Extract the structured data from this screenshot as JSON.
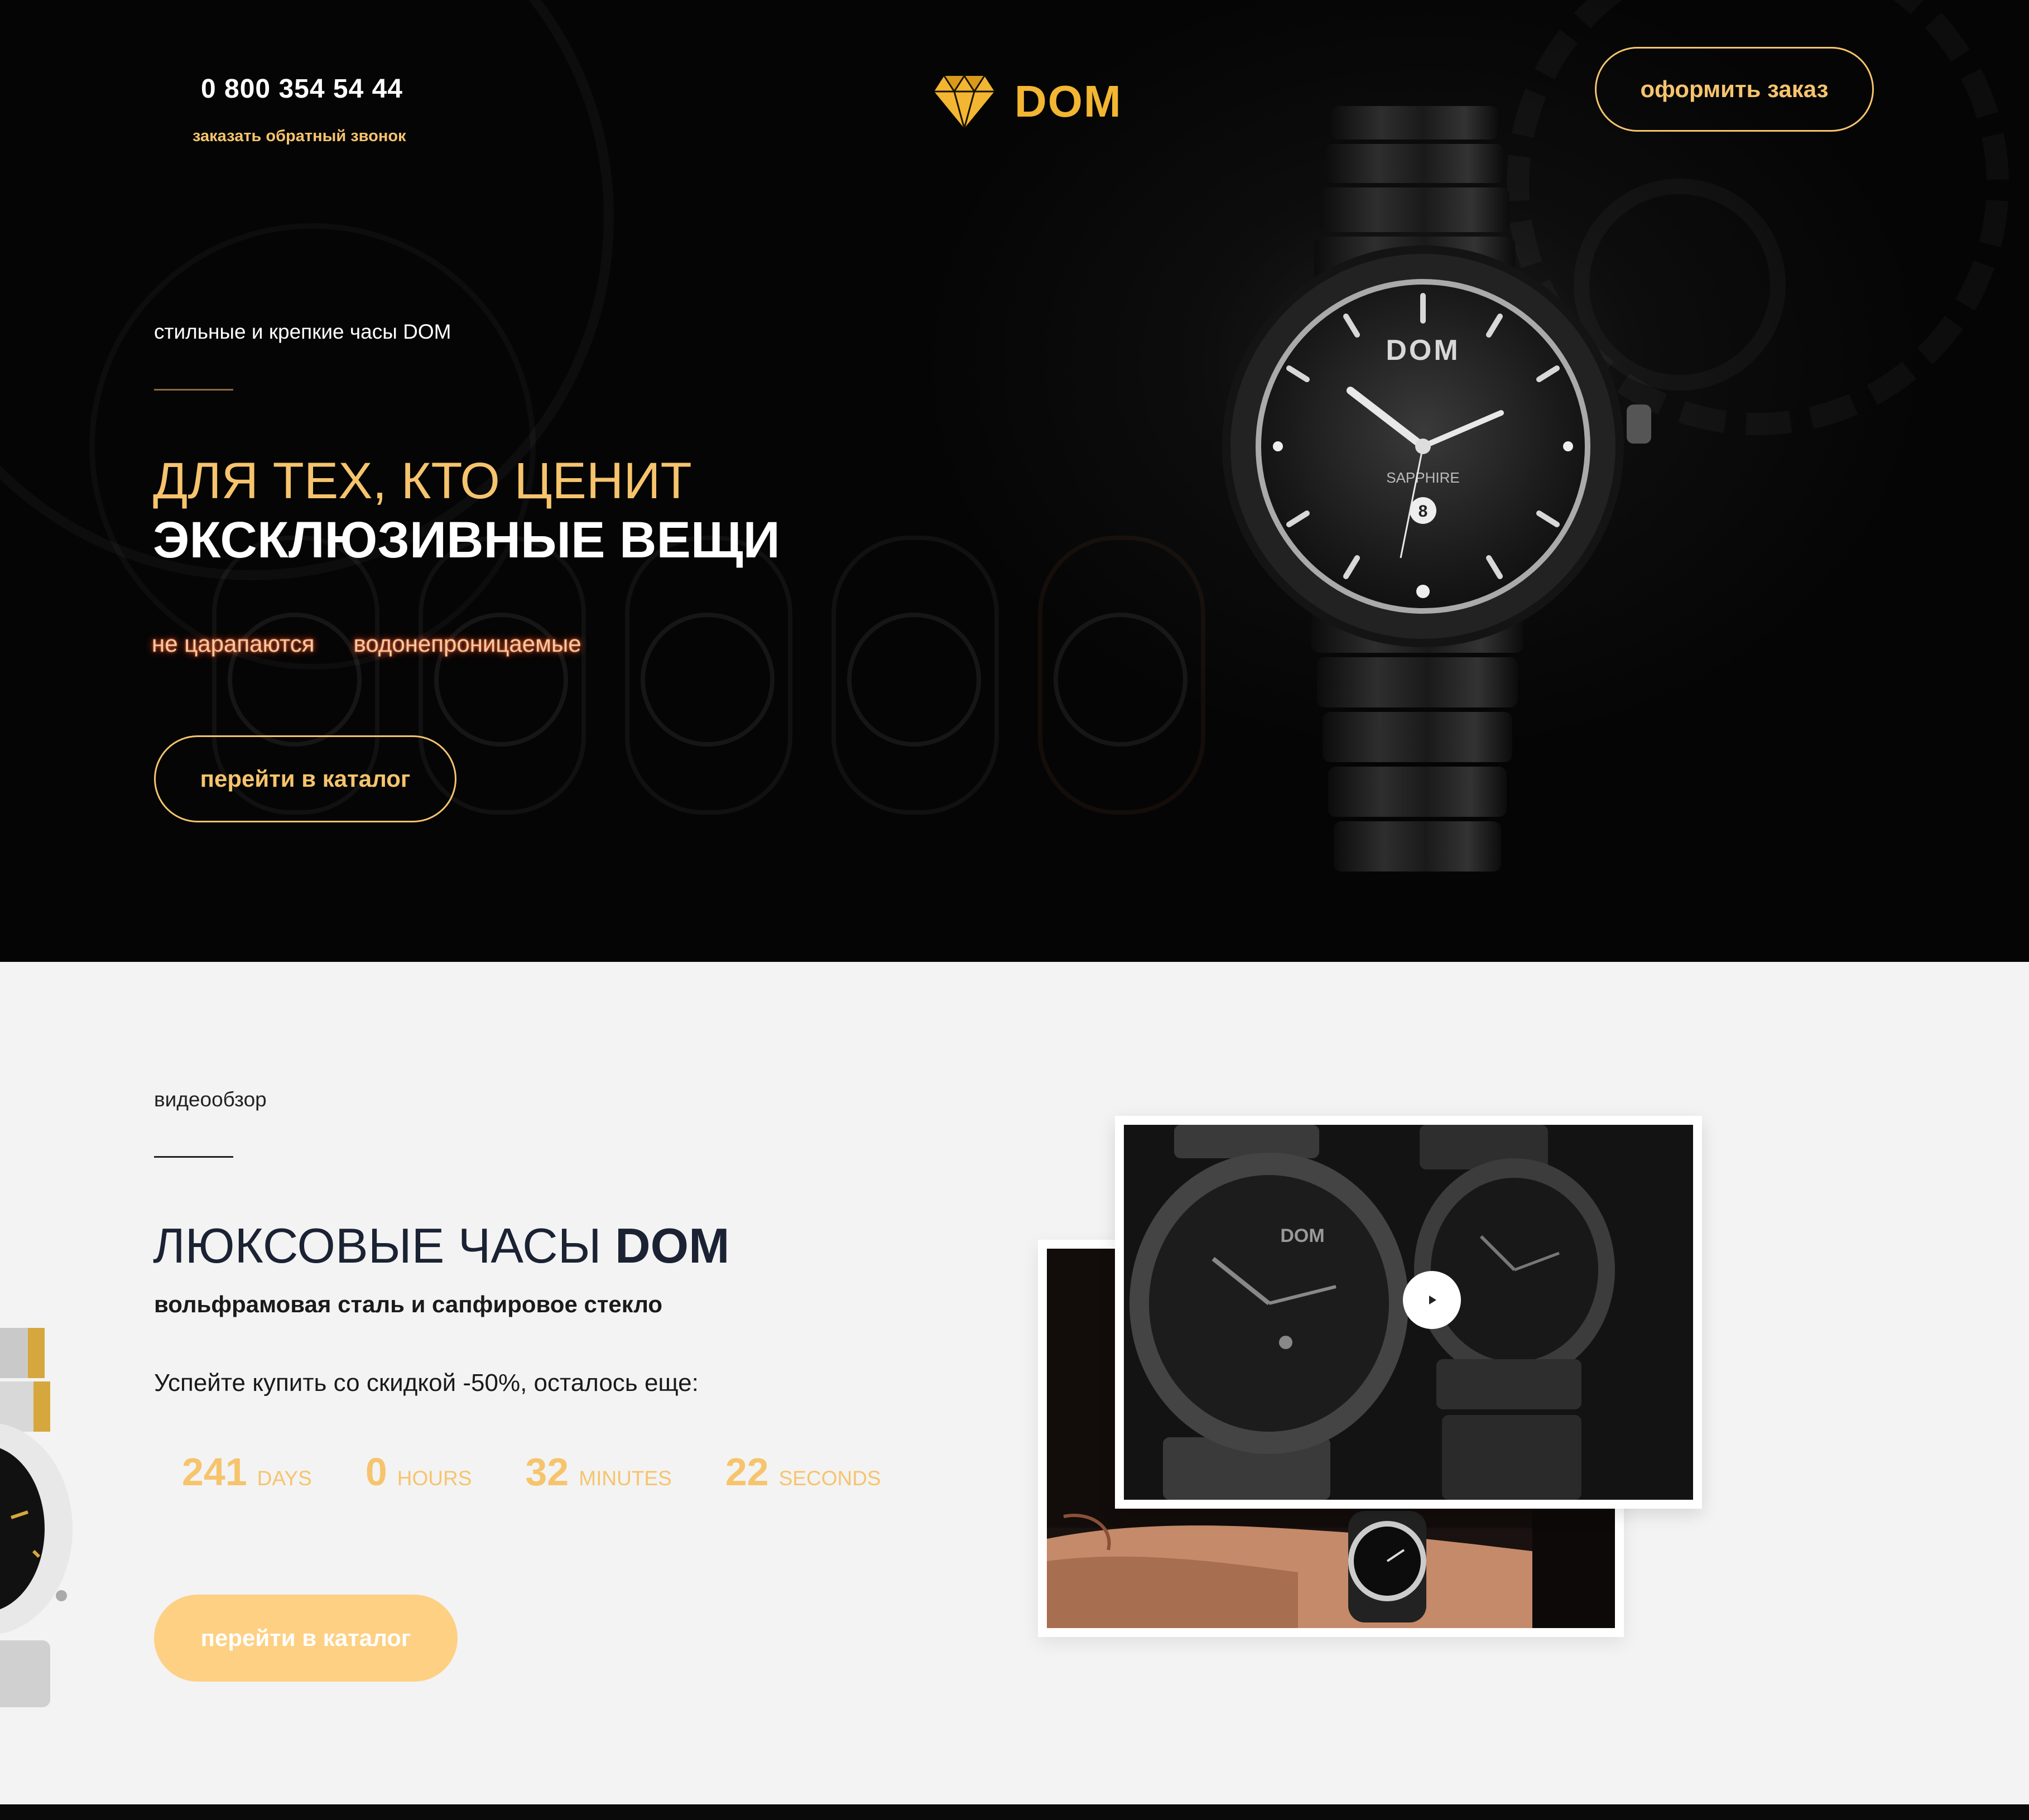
{
  "header": {
    "phone": "0 800 354 54 44",
    "callback_link": "заказать обратный звонок",
    "logo_text": "DOM",
    "order_button": "оформить заказ"
  },
  "hero": {
    "subtitle": "стильные и крепкие часы DOM",
    "headline_line1": "ДЛЯ ТЕХ, КТО ЦЕНИТ",
    "headline_line2": "ЭКСКЛЮЗИВНЫЕ ВЕЩИ",
    "features": [
      "не царапаются",
      "водонепроницаемые"
    ],
    "catalog_button": "перейти в каталог",
    "watch_dial_brand": "DOM",
    "watch_dial_text": "SAPPHIRE",
    "watch_date": "8"
  },
  "video_section": {
    "label": "видеообзор",
    "title_light": "ЛЮКСОВЫЕ ЧАСЫ ",
    "title_bold": "DOM",
    "subtitle": "вольфрамовая сталь и сапфировое стекло",
    "promo": "Успейте купить со скидкой -50%, осталось еще:",
    "countdown": [
      {
        "value": "241",
        "unit": "DAYS"
      },
      {
        "value": "0",
        "unit": "HOURS"
      },
      {
        "value": "32",
        "unit": "MINUTES"
      },
      {
        "value": "22",
        "unit": "SECONDS"
      }
    ],
    "catalog_button": "перейти в каталог",
    "video_dial_brand": "DOM"
  },
  "colors": {
    "accent_gold": "#f6c46d",
    "logo_gold": "#f2b632",
    "button_fill": "#fed083",
    "hero_bg": "#060606",
    "section_bg": "#f3f3f3"
  },
  "icons": [
    "diamond-logo-icon",
    "play-icon"
  ]
}
